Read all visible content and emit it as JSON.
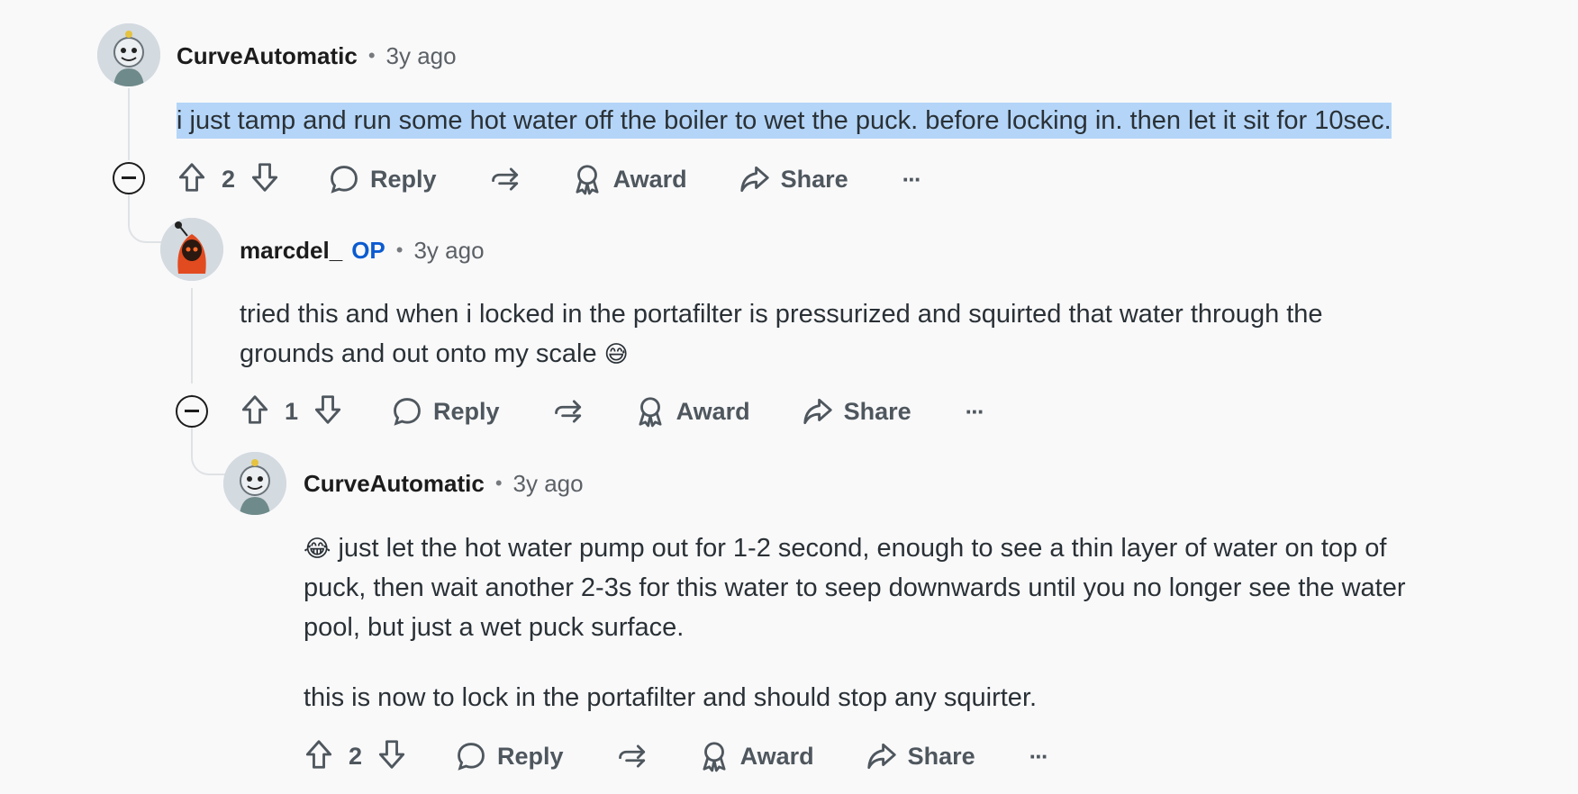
{
  "comments": [
    {
      "username": "CurveAutomatic",
      "op_badge": "",
      "time": "3y ago",
      "lines": [
        "i just tamp and run some hot water off the boiler to wet the puck. before locking in. then let it sit for 10sec."
      ],
      "votes": "2",
      "reply": "Reply",
      "award": "Award",
      "share": "Share",
      "more": "···"
    },
    {
      "username": "marcdel_",
      "op_badge": "OP",
      "time": "3y ago",
      "lines": [
        "tried this and when i locked in the portafilter is pressurized and squirted that water through the",
        "grounds and out onto my scale"
      ],
      "emoji_end": "😅",
      "votes": "1",
      "reply": "Reply",
      "award": "Award",
      "share": "Share",
      "more": "···"
    },
    {
      "username": "CurveAutomatic",
      "op_badge": "",
      "time": "3y ago",
      "emoji_start": "😂",
      "lines": [
        "just let the hot water pump out for 1-2 second, enough to see a thin layer of water on top of",
        "puck, then wait another 2-3s for this water to seep downwards until you no longer see the water",
        "pool, but just a wet puck surface.",
        "this is now to lock in the portafilter and should stop any squirter."
      ],
      "votes": "2",
      "reply": "Reply",
      "award": "Award",
      "share": "Share",
      "more": "···"
    }
  ]
}
